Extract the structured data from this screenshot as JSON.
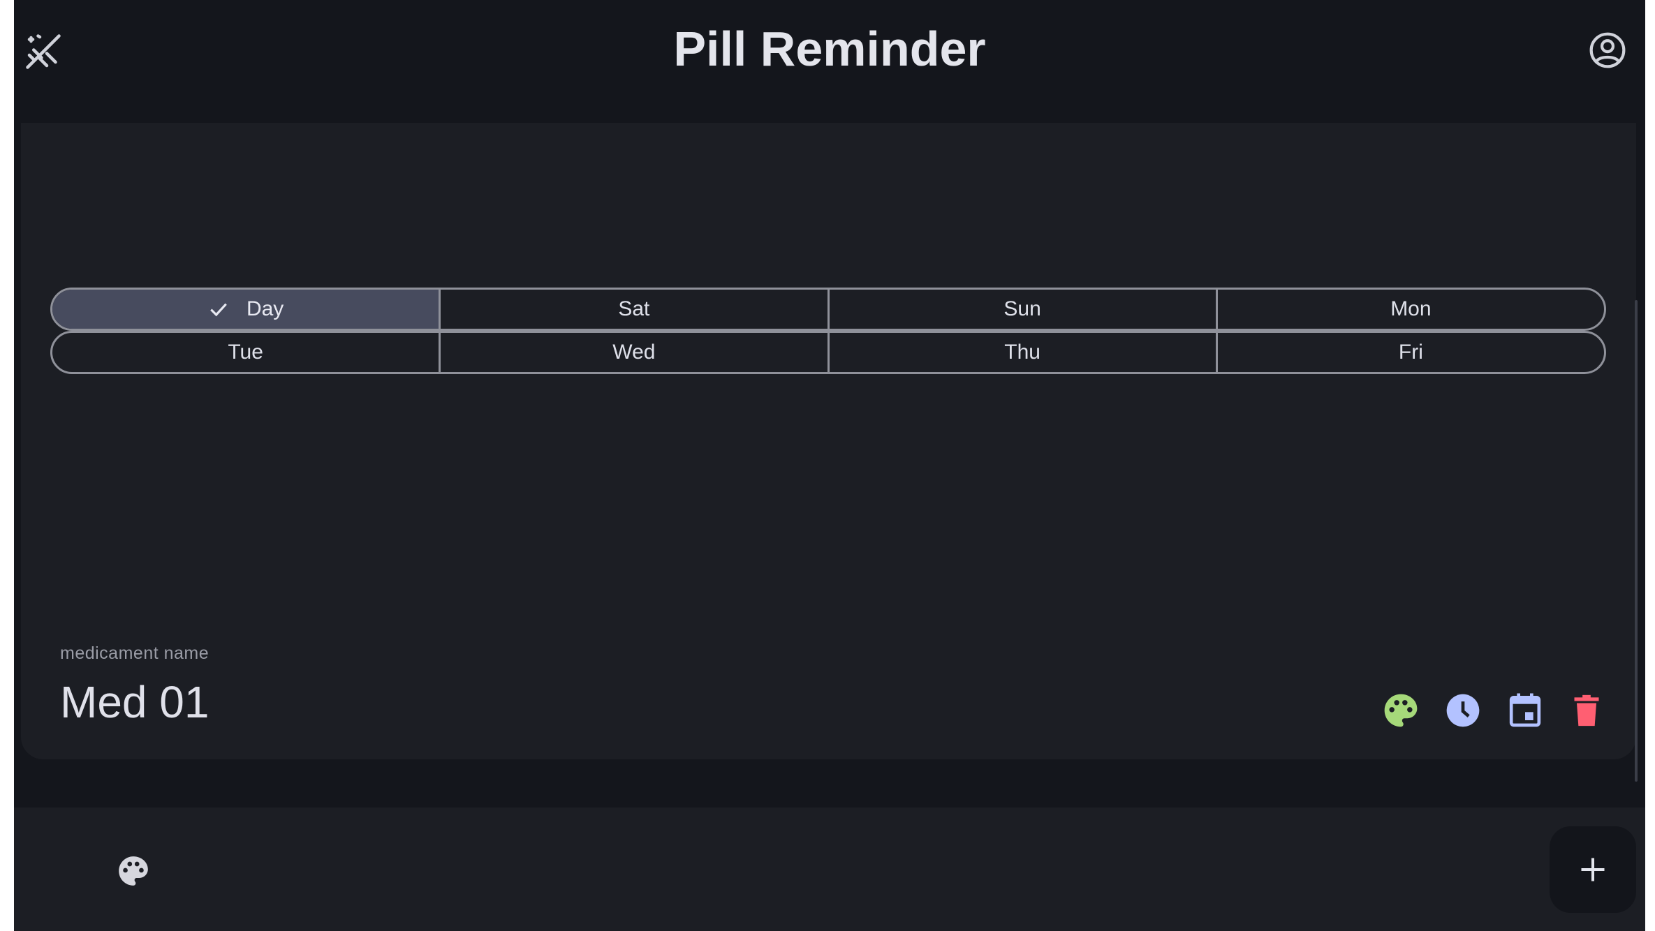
{
  "app": {
    "title": "Pill Reminder",
    "colors": {
      "background": "#14161c",
      "card": "#1c1e24",
      "selected_segment": "#474b5e",
      "palette_action": "#a6d97a",
      "time_action": "#b3c2ff",
      "calendar_action": "#b3c2ff",
      "delete_action": "#ff5f72"
    }
  },
  "topbar": {
    "left_icon": "pill-off-icon",
    "right_icon": "account-circle-icon"
  },
  "schedule": {
    "row1": [
      {
        "label": "Day",
        "selected": true
      },
      {
        "label": "Sat",
        "selected": false
      },
      {
        "label": "Sun",
        "selected": false
      },
      {
        "label": "Mon",
        "selected": false
      }
    ],
    "row2": [
      {
        "label": "Tue",
        "selected": false
      },
      {
        "label": "Wed",
        "selected": false
      },
      {
        "label": "Thu",
        "selected": false
      },
      {
        "label": "Fri",
        "selected": false
      }
    ]
  },
  "medicament": {
    "name_label": "medicament name",
    "name_value": "Med 01",
    "actions": [
      "palette-icon",
      "clock-icon",
      "calendar-icon",
      "delete-icon"
    ]
  },
  "bottombar": {
    "left_icon": "palette-icon",
    "fab_icon": "plus-icon"
  }
}
